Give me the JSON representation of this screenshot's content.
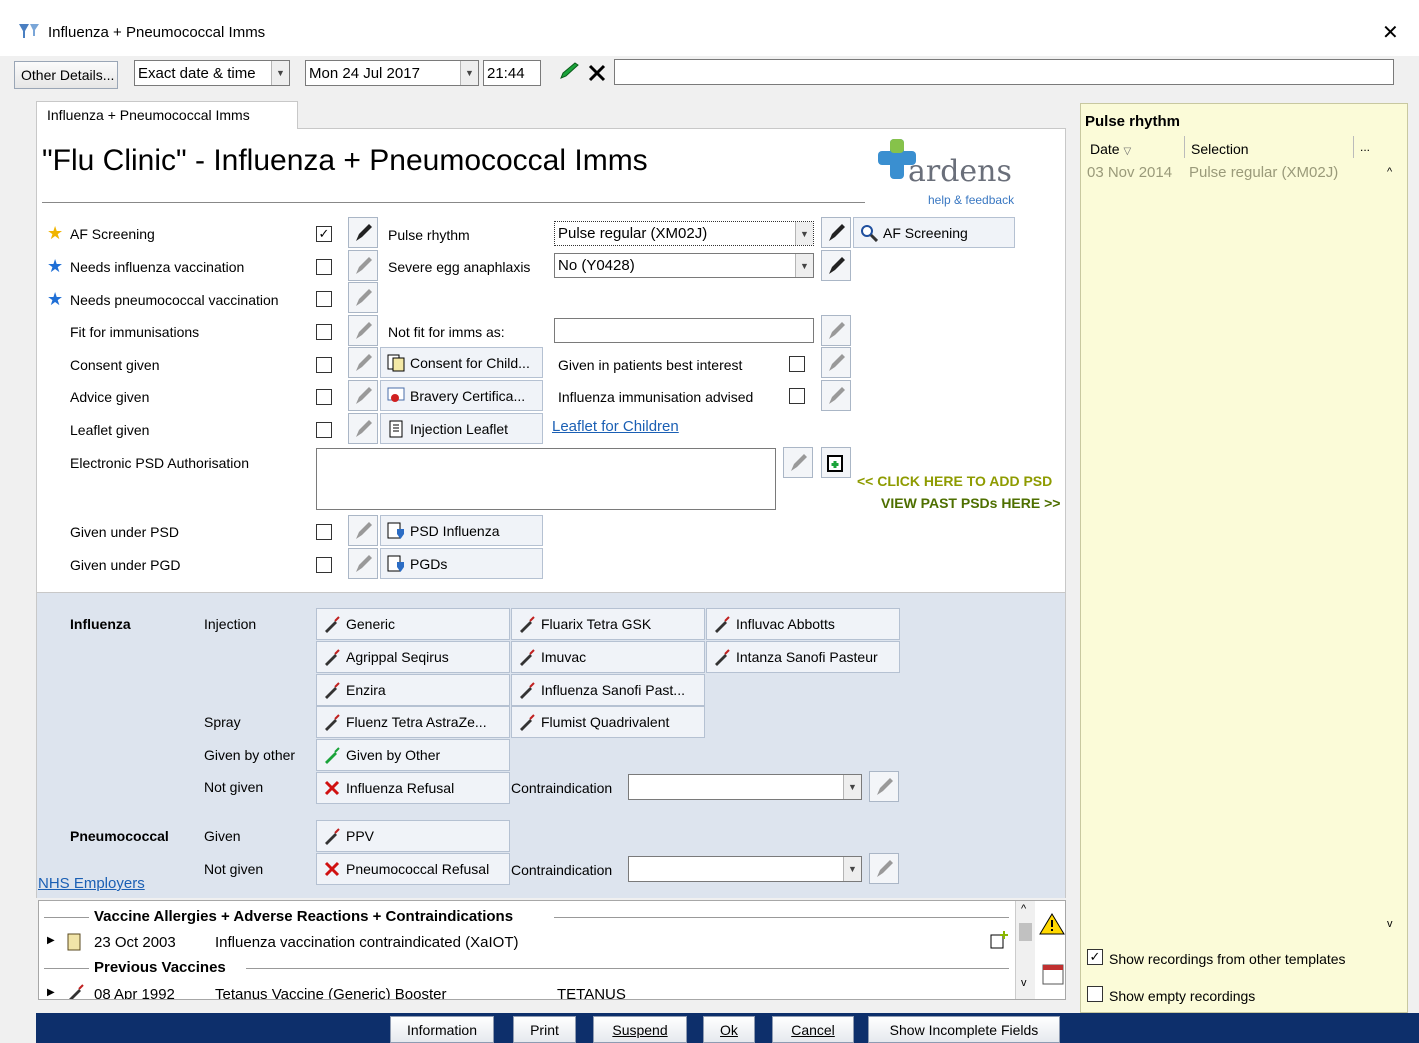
{
  "window": {
    "title": "Influenza + Pneumococcal Imms",
    "close_glyph": "✕"
  },
  "toolbar": {
    "other_details": "Other Details...",
    "date_mode": "Exact date & time",
    "date": "Mon 24 Jul 2017",
    "time": "21:44",
    "free_text": ""
  },
  "tab": {
    "label": "Influenza + Pneumococcal Imms"
  },
  "page": {
    "heading": "\"Flu Clinic\" - Influenza + Pneumococcal Imms"
  },
  "logo": {
    "brand": "ardens",
    "help": "help & feedback"
  },
  "rows": {
    "af_screening": "AF Screening",
    "needs_flu": "Needs influenza vaccination",
    "needs_pneumo": "Needs pneumococcal vaccination",
    "fit": "Fit for immunisations",
    "consent": "Consent given",
    "advice": "Advice given",
    "leaflet": "Leaflet given",
    "psd_auth": "Electronic PSD Authorisation",
    "under_psd": "Given under PSD",
    "under_pgd": "Given under PGD"
  },
  "mid": {
    "pulse_label": "Pulse rhythm",
    "pulse_value": "Pulse regular (XM02J)",
    "egg_label": "Severe egg anaphlaxis",
    "egg_value": "No (Y0428)",
    "notfit_label": "Not fit for imms as:",
    "consent_child": "Consent for Child...",
    "bravery": "Bravery Certifica...",
    "injection_leaflet": "Injection Leaflet",
    "best_interest": "Given in patients best interest",
    "flu_advised": "Influenza immunisation advised",
    "leaflet_children": "Leaflet for Children",
    "af_screening_btn": "AF Screening",
    "psd_influenza": "PSD Influenza",
    "pgds": "PGDs",
    "click_add_psd": "<< CLICK HERE TO ADD PSD",
    "view_past_psd": "VIEW PAST PSDs HERE >>"
  },
  "influenza": {
    "title": "Influenza",
    "injection": "Injection",
    "spray": "Spray",
    "given_by_other": "Given by other",
    "not_given": "Not given",
    "btn_generic": "Generic",
    "btn_fluarix": "Fluarix Tetra GSK",
    "btn_influvac": "Influvac Abbotts",
    "btn_agrippal": "Agrippal Seqirus",
    "btn_imuvac": "Imuvac",
    "btn_intanza": "Intanza Sanofi Pasteur",
    "btn_enzira": "Enzira",
    "btn_sanofi": "Influenza Sanofi Past...",
    "btn_fluenz": "Fluenz Tetra AstraZe...",
    "btn_flumist": "Flumist Quadrivalent",
    "btn_other": "Given by Other",
    "btn_refusal": "Influenza Refusal",
    "contraindication": "Contraindication"
  },
  "pneumo": {
    "title": "Pneumococcal",
    "given": "Given",
    "not_given": "Not given",
    "btn_ppv": "PPV",
    "btn_refusal": "Pneumococcal Refusal",
    "contraindication": "Contraindication"
  },
  "nhs_link": "NHS Employers",
  "history": {
    "section1": "Vaccine Allergies + Adverse Reactions + Contraindications",
    "row1_date": "23 Oct 2003",
    "row1_text": "Influenza vaccination contraindicated (XaIOT)",
    "section2": "Previous Vaccines",
    "row2_date": "08 Apr 1992",
    "row2_text": "Tetanus Vaccine (Generic) Booster",
    "row2_extra": "TETANUS"
  },
  "right_panel": {
    "title": "Pulse rhythm",
    "col_date": "Date",
    "col_selection": "Selection",
    "col_more": "...",
    "row_date": "03 Nov 2014",
    "row_selection": "Pulse regular (XM02J)",
    "show_other": "Show recordings from other templates",
    "show_empty": "Show empty recordings"
  },
  "footer": {
    "information": "Information",
    "print": "Print",
    "suspend": "Suspend",
    "ok": "Ok",
    "cancel": "Cancel",
    "incomplete": "Show Incomplete Fields"
  },
  "colors": {
    "accent_blue": "#0d2f6b",
    "link": "#1a5fb4",
    "psd_green": "#6b8e00",
    "refusal_red": "#d01010"
  }
}
